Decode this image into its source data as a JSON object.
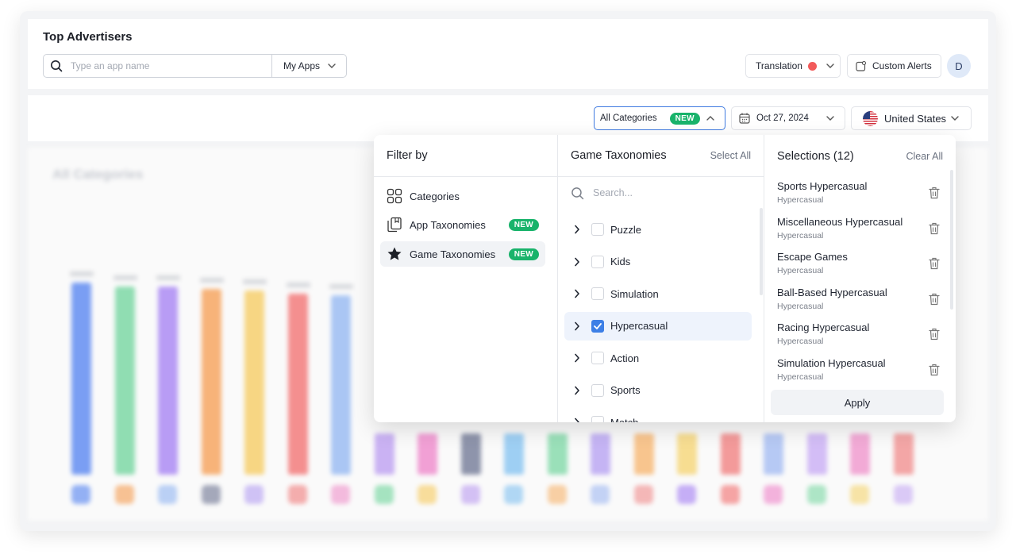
{
  "header": {
    "title": "Top Advertisers",
    "search_placeholder": "Type an app name",
    "myapps_label": "My Apps",
    "translation_label": "Translation",
    "custom_alerts_label": "Custom Alerts",
    "avatar_initial": "D"
  },
  "filters": {
    "category_label": "All Categories",
    "category_badge": "NEW",
    "date_label": "Oct 27, 2024",
    "country_label": "United States"
  },
  "chart": {
    "title": "All Categories"
  },
  "panel": {
    "filter_by": {
      "title": "Filter by",
      "items": [
        {
          "label": "Categories",
          "icon": "grid-icon",
          "badge": ""
        },
        {
          "label": "App Taxonomies",
          "icon": "book-icon",
          "badge": "NEW"
        },
        {
          "label": "Game Taxonomies",
          "icon": "star-icon",
          "badge": "NEW"
        }
      ]
    },
    "taxonomies": {
      "title": "Game Taxonomies",
      "select_all": "Select All",
      "search_placeholder": "Search...",
      "items": [
        {
          "label": "Puzzle",
          "checked": false
        },
        {
          "label": "Kids",
          "checked": false
        },
        {
          "label": "Simulation",
          "checked": false
        },
        {
          "label": "Hypercasual",
          "checked": true
        },
        {
          "label": "Action",
          "checked": false
        },
        {
          "label": "Sports",
          "checked": false
        },
        {
          "label": "Match",
          "checked": false
        }
      ]
    },
    "selections": {
      "title": "Selections (12)",
      "clear_all": "Clear All",
      "apply_label": "Apply",
      "items": [
        {
          "name": "Sports Hypercasual",
          "sub": "Hypercasual"
        },
        {
          "name": "Miscellaneous Hypercasual",
          "sub": "Hypercasual"
        },
        {
          "name": "Escape Games",
          "sub": "Hypercasual"
        },
        {
          "name": "Ball-Based Hypercasual",
          "sub": "Hypercasual"
        },
        {
          "name": "Racing Hypercasual",
          "sub": "Hypercasual"
        },
        {
          "name": "Simulation Hypercasual",
          "sub": "Hypercasual"
        }
      ]
    }
  },
  "colors": {
    "accent": "#3f7ae0",
    "badge_green": "#19b36b",
    "status_red": "#f25a5a"
  }
}
